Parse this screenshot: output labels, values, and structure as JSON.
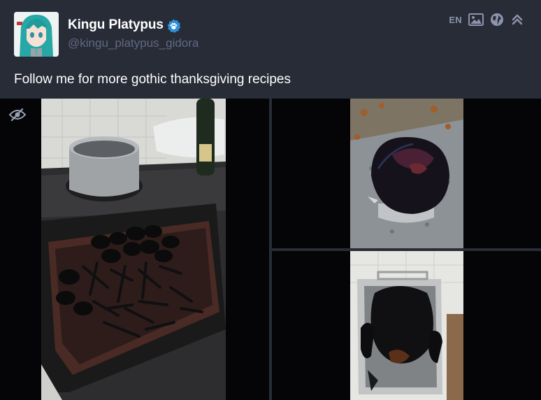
{
  "account": {
    "display_name": "Kingu Platypus",
    "handle": "@kingu_platypus_gidora",
    "avatar_icon": "anime-avatar",
    "verified_icon": "paw-badge-icon"
  },
  "status_meta": {
    "language": "EN",
    "icons": [
      "image-icon",
      "globe-icon",
      "collapse-icon"
    ]
  },
  "status": {
    "text": "Follow me for more gothic thanksgiving recipes"
  },
  "media": {
    "hide_icon": "eye-slash-icon",
    "items": [
      {
        "description": "photo of a charred baking tray with burnt food"
      },
      {
        "description": "photo of a burnt pot on pavement"
      },
      {
        "description": "photo of a blackened roast turkey in a roasting pan"
      }
    ]
  },
  "colors": {
    "background": "#282c37",
    "text": "#ffffff",
    "secondary_text": "#606984",
    "icon": "#8c93ad",
    "accent": "#2b90d9",
    "media_background": "#050507"
  }
}
